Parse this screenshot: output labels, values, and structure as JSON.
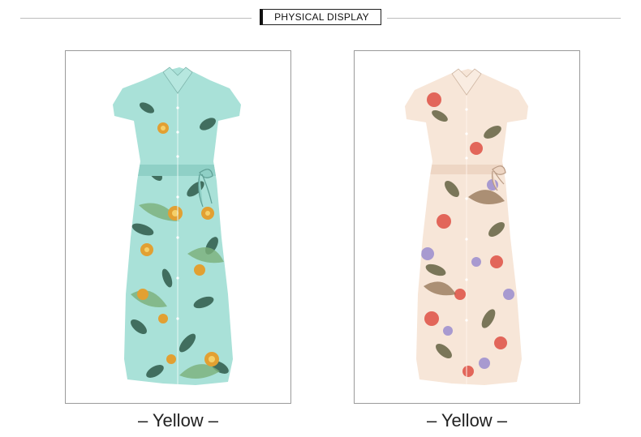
{
  "header": {
    "title": "PHYSICAL DISPLAY"
  },
  "products": [
    {
      "caption": "– Yellow –",
      "icon": "teal-floral-dress-image",
      "base_color": "#a9e1d8",
      "accent_color": "#e2a032",
      "leaf_color": "#2f5a4a"
    },
    {
      "caption": "– Yellow –",
      "icon": "cream-floral-dress-image",
      "base_color": "#f7e6d8",
      "accent_color": "#e2665a",
      "leaf_color": "#5a5a3a"
    }
  ]
}
